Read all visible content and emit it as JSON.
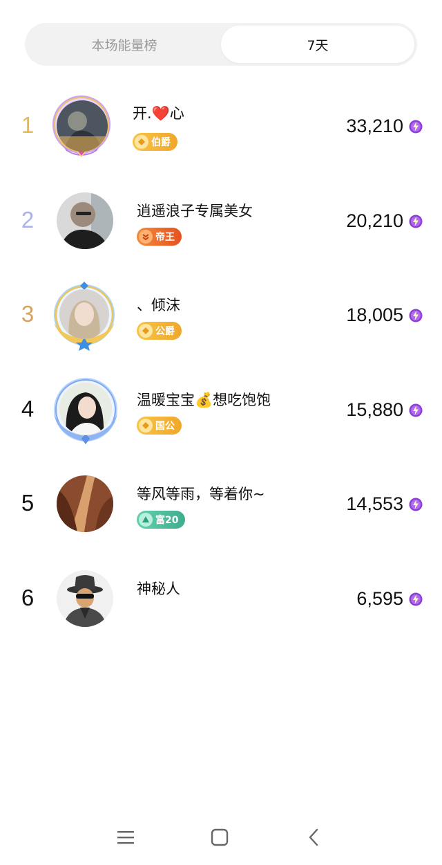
{
  "tabs": [
    {
      "label": "本场能量榜",
      "active": false
    },
    {
      "label": "7天",
      "active": true
    }
  ],
  "rows": [
    {
      "rank": "1",
      "name_pre": "开.",
      "name_emoji": "❤️",
      "name_post": "心",
      "badge": "伯爵",
      "score": "33,210",
      "rank_color": "#e9b84a"
    },
    {
      "rank": "2",
      "name": "逍遥浪子专属美女",
      "badge": "帝王",
      "score": "20,210",
      "rank_color": "#a9b3ea"
    },
    {
      "rank": "3",
      "name": "、倾沫",
      "badge": "公爵",
      "score": "18,005",
      "rank_color": "#d8a25e"
    },
    {
      "rank": "4",
      "name_pre": "温暖宝宝",
      "name_emoji": "💰",
      "name_post": "想吃饱饱",
      "badge": "国公",
      "score": "15,880",
      "rank_color": "#111111"
    },
    {
      "rank": "5",
      "name": "等风等雨，等着你~",
      "badge": "富20",
      "score": "14,553",
      "rank_color": "#111111"
    },
    {
      "rank": "6",
      "name": "神秘人",
      "score": "6,595",
      "rank_color": "#111111"
    }
  ],
  "colors": {
    "badge_gold": "#f2b82e",
    "badge_orange": "#f26b2a",
    "badge_teal": "#4fbf9f",
    "energy_purple": "#8b3fd9"
  },
  "icons": {
    "energy": "lightning-bolt-icon",
    "nav": [
      "menu-icon",
      "home-square-icon",
      "back-chevron-icon"
    ]
  }
}
